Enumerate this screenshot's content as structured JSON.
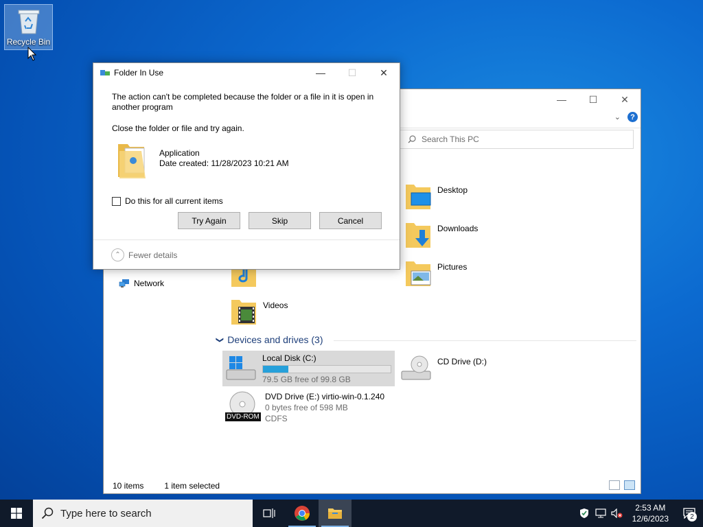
{
  "desktop": {
    "recycle_bin_label": "Recycle Bin"
  },
  "explorer": {
    "search_placeholder": "Search This PC",
    "nav_network": "Network",
    "folders": [
      {
        "label": "Desktop"
      },
      {
        "label": "Downloads"
      },
      {
        "label": "Pictures"
      },
      {
        "label": "Videos"
      }
    ],
    "drives_header": "Devices and drives (3)",
    "drives": {
      "c": {
        "name": "Local Disk (C:)",
        "free": "79.5 GB free of 99.8 GB",
        "used_fraction": 0.2
      },
      "d": {
        "name": "CD Drive (D:)"
      },
      "e": {
        "name": "DVD Drive (E:) virtio-win-0.1.240",
        "free": "0 bytes free of 598 MB",
        "fs": "CDFS",
        "badge": "DVD-ROM"
      }
    },
    "status_items": "10 items",
    "status_selected": "1 item selected"
  },
  "dialog": {
    "title": "Folder In Use",
    "message": "The action can't be completed because the folder or a file in it is open in another program",
    "instruction": "Close the folder or file and try again.",
    "file_name": "Application",
    "file_date": "Date created: 11/28/2023 10:21 AM",
    "checkbox_label": "Do this for all current items",
    "btn_try_again": "Try Again",
    "btn_skip": "Skip",
    "btn_cancel": "Cancel",
    "details_label": "Fewer details"
  },
  "taskbar": {
    "search_placeholder": "Type here to search",
    "time": "2:53 AM",
    "date": "12/6/2023",
    "notification_count": "2"
  }
}
